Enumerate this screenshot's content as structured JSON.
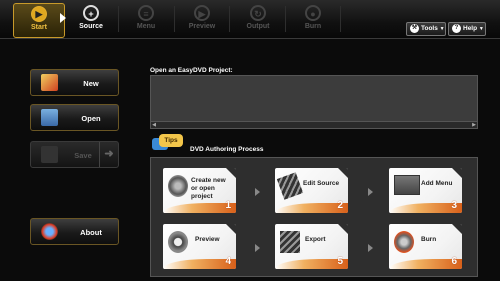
{
  "toolbar": {
    "steps": [
      {
        "label": "Start",
        "icon": "play-icon",
        "state": "active"
      },
      {
        "label": "Source",
        "icon": "plus-icon",
        "state": "normal"
      },
      {
        "label": "Menu",
        "icon": "menu-icon",
        "state": "disabled"
      },
      {
        "label": "Preview",
        "icon": "preview-icon",
        "state": "disabled"
      },
      {
        "label": "Output",
        "icon": "output-icon",
        "state": "disabled"
      },
      {
        "label": "Burn",
        "icon": "burn-icon",
        "state": "disabled"
      }
    ],
    "tools_label": "Tools",
    "help_label": "Help"
  },
  "sidebar": {
    "new_label": "New",
    "open_label": "Open",
    "save_label": "Save",
    "about_label": "About"
  },
  "project": {
    "label": "Open an EasyDVD Project:"
  },
  "tips": {
    "badge": "Tips",
    "title": "DVD Authoring Process"
  },
  "process": [
    {
      "text": "Create new or open project",
      "num": "1",
      "icon": "dvd-disc-icon"
    },
    {
      "text": "Edit Source",
      "num": "2",
      "icon": "film-strip-icon"
    },
    {
      "text": "Add Menu",
      "num": "3",
      "icon": "menu-title-icon"
    },
    {
      "text": "Preview",
      "num": "4",
      "icon": "preview-play-icon"
    },
    {
      "text": "Export",
      "num": "5",
      "icon": "film-export-icon"
    },
    {
      "text": "Burn",
      "num": "6",
      "icon": "flaming-disc-icon"
    }
  ],
  "colors": {
    "accent": "#e0a820",
    "swoosh": "#d8601a",
    "tips_badge": "#f3c64a"
  }
}
